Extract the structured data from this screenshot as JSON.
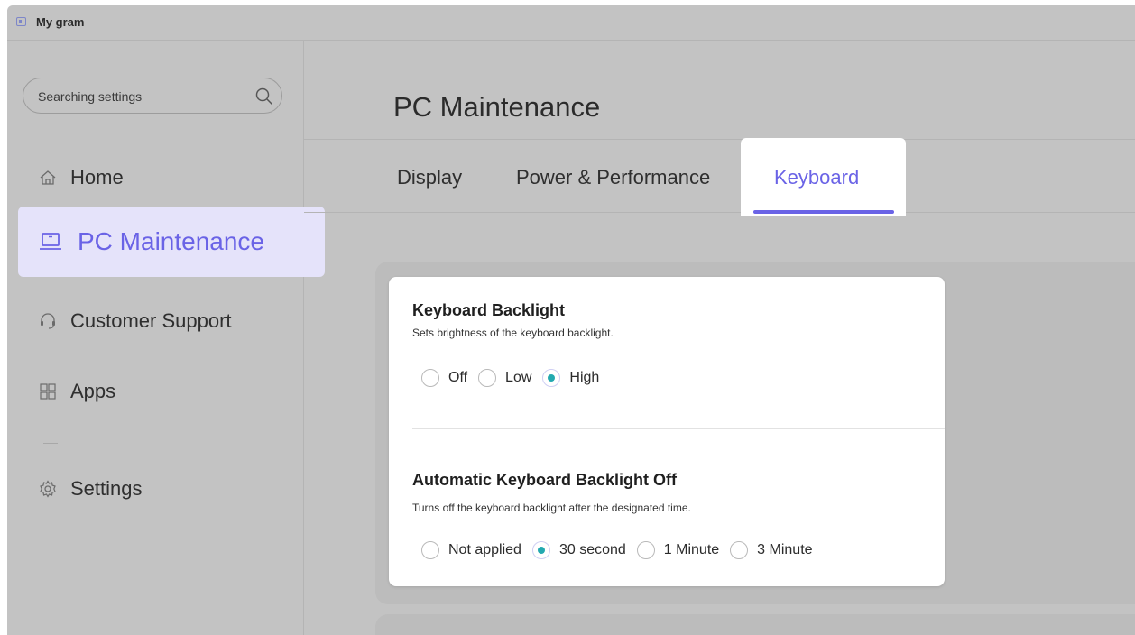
{
  "app": {
    "title": "My gram"
  },
  "search": {
    "placeholder": "Searching settings"
  },
  "sidebar": {
    "items": [
      {
        "label": "Home"
      },
      {
        "label": "PC Maintenance"
      },
      {
        "label": "Customer Support"
      },
      {
        "label": "Apps"
      },
      {
        "label": "Settings"
      }
    ]
  },
  "main": {
    "title": "PC Maintenance",
    "tabs": [
      {
        "label": "Display"
      },
      {
        "label": "Power & Performance"
      },
      {
        "label": "Keyboard"
      }
    ],
    "sections": [
      {
        "title": "Keyboard Backlight",
        "description": "Sets brightness of the keyboard backlight.",
        "options": [
          "Off",
          "Low",
          "High"
        ],
        "selected": "High"
      },
      {
        "title": "Automatic Keyboard Backlight Off",
        "description": "Turns off the keyboard backlight after the designated time.",
        "options": [
          "Not applied",
          "30 second",
          "1 Minute",
          "3 Minute"
        ],
        "selected": "30 second"
      }
    ]
  },
  "colors": {
    "accent": "#6a63e6",
    "radio_selected": "#23a9b0",
    "active_bg": "#e5e3fa"
  }
}
